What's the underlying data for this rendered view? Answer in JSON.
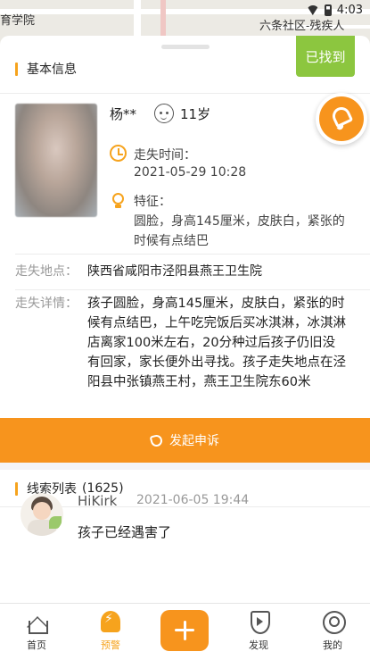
{
  "status_bar": {
    "time": "4:03"
  },
  "map": {
    "label_left": "育学院",
    "label_right": "六条社区-残疾人"
  },
  "badge": {
    "found": "已找到"
  },
  "basic_info": {
    "title": "基本信息",
    "name": "杨**",
    "age": "11岁",
    "missing_time_label": "走失时间：",
    "missing_time": "2021-05-29 10:28",
    "features_label": "特征：",
    "features": "圆脸，身高145厘米，皮肤白，紧张的时候有点结巴",
    "location_label": "走失地点：",
    "location": "陕西省咸阳市泾阳县燕王卫生院",
    "details_label": "走失详情：",
    "details": "孩子圆脸，身高145厘米，皮肤白，紧张的时候有点结巴，上午吃完饭后买冰淇淋，冰淇淋店离家100米左右，20分种过后孩子仍旧没有回家，家长便外出寻找。孩子走失地点在泾阳县中张镇燕王村，燕王卫生院东60米"
  },
  "appeal_button": "发起申诉",
  "clues": {
    "title": "线索列表",
    "count": "(1625)",
    "items": [
      {
        "user": "HiKirk",
        "time": "2021-06-05 19:44",
        "text": "孩子已经遇害了"
      }
    ]
  },
  "tabbar": {
    "items": [
      {
        "label": "首页"
      },
      {
        "label": "预警"
      },
      {
        "label": "发现"
      },
      {
        "label": "我的"
      }
    ]
  },
  "colors": {
    "accent": "#f7941d",
    "found": "#8cc63f"
  },
  "icons": [
    "clock-icon",
    "bulb-icon",
    "child-face-icon",
    "bell-icon",
    "phone-icon",
    "home-icon",
    "alert-icon",
    "plus-icon",
    "discover-icon",
    "profile-icon"
  ]
}
